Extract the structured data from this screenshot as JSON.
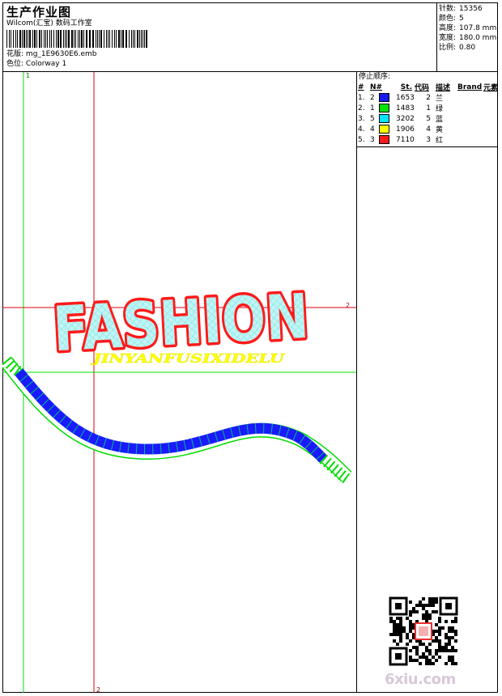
{
  "header": {
    "title": "生产作业图",
    "company": "Wilcom(汇宝) 数码工作室",
    "design_label": "花版:",
    "design_file": "mg_1E9630E6.emb",
    "color_label": "色位:",
    "colorway": "Colorway 1"
  },
  "info": [
    {
      "label": "针数:",
      "value": "15356"
    },
    {
      "label": "颜色:",
      "value": "5"
    },
    {
      "label": "高度:",
      "value": "107.8 mm"
    },
    {
      "label": "宽度:",
      "value": "180.0 mm"
    },
    {
      "label": "比例:",
      "value": "0.80"
    }
  ],
  "sequence": {
    "title": "停止顺序:",
    "columns": [
      "#",
      "N#",
      "St.",
      "代码",
      "描述",
      "Brand",
      "元素"
    ],
    "rows": [
      {
        "idx": "1.",
        "n": "2",
        "color": "#1a1aff",
        "code": "1653",
        "st": "2",
        "desc": "兰"
      },
      {
        "idx": "2.",
        "n": "1",
        "color": "#00e000",
        "code": "1483",
        "st": "1",
        "desc": "绿"
      },
      {
        "idx": "3.",
        "n": "5",
        "color": "#00e5ff",
        "code": "3202",
        "st": "5",
        "desc": "蓝"
      },
      {
        "idx": "4.",
        "n": "4",
        "color": "#ffff00",
        "code": "1906",
        "st": "4",
        "desc": "黄"
      },
      {
        "idx": "5.",
        "n": "3",
        "color": "#ff1a1a",
        "code": "7110",
        "st": "3",
        "desc": "红"
      }
    ]
  },
  "design": {
    "main_text": "FASHION",
    "sub_text": "JINYANFUSIXIDELU",
    "guide_markers": {
      "v1": "1",
      "h1": "1",
      "h2": "2",
      "v2": "2"
    }
  },
  "watermark": "6xiu.com",
  "colors": {
    "red_guide": "#e0000f",
    "green_guide": "#00e000",
    "fill_light": "#bff5f5",
    "outline_red": "#ff1a1a",
    "blue": "#1a1aff",
    "yellow": "#ffff00",
    "watermark": "#d8c8d8"
  }
}
